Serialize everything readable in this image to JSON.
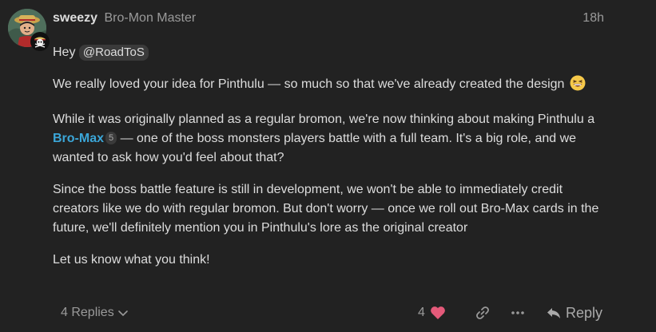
{
  "post": {
    "username": "sweezy",
    "user_title": "Bro-Mon Master",
    "date": "18h",
    "avatar_icon": "user-avatar",
    "flair_icon": "skull-flair-icon"
  },
  "body": {
    "greeting": "Hey",
    "mention": "@RoadToS",
    "para1": "We really loved your idea for Pinthulu — so much so that we've already created the design",
    "para1_emoji": "grinning-squinting-face-emoji",
    "para2_before": "While it was originally planned as a regular bromon, we're now thinking about making Pinthulu a",
    "para2_tag": "Bro-Max",
    "para2_tag_count": "5",
    "para2_after": " — one of the boss monsters players battle with a full team. It's a big role, and we wanted to ask how you'd feel about that?",
    "para3": "Since the boss battle feature is still in development, we won't be able to immediately credit creators like we do with regular bromon. But don't worry — once we roll out Bro-Max cards in the future, we'll definitely mention you in Pinthulu's lore as the original creator",
    "para4": "Let us know what you think!"
  },
  "controls": {
    "replies_label": "4 Replies",
    "like_count": "4",
    "reply_label": "Reply",
    "colors": {
      "heart": "#e45a7a",
      "link": "#3ba6d8",
      "muted": "#9a9a9a",
      "text": "#dddddd",
      "background": "#222222"
    }
  }
}
